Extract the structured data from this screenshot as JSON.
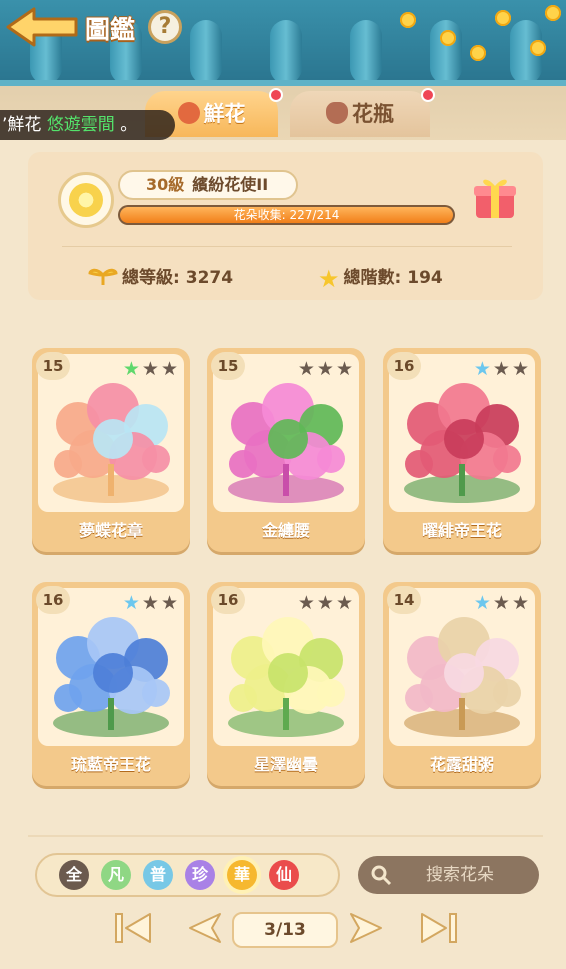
{
  "header": {
    "title": "圖鑑",
    "help": "?"
  },
  "ticker": {
    "prefix": "’鮮花 ",
    "highlight": "悠遊雲間",
    "suffix": " 。"
  },
  "tabs": [
    {
      "label": "鮮花",
      "active": true
    },
    {
      "label": "花瓶",
      "active": false
    }
  ],
  "profile": {
    "level": "30級",
    "rank_title": "繽紛花使II",
    "progress_label": "花朵收集:",
    "progress_value": "227/214",
    "progress_fraction": 1.0,
    "total_level_label": "總等級:",
    "total_level": "3274",
    "total_rank_label": "總階數:",
    "total_rank": "194"
  },
  "cards": [
    {
      "name": "夢蝶花章",
      "level": "15",
      "stars": [
        "green",
        "off",
        "off"
      ]
    },
    {
      "name": "金纏腰",
      "level": "15",
      "stars": [
        "off",
        "off",
        "off"
      ]
    },
    {
      "name": "曜緋帝王花",
      "level": "16",
      "stars": [
        "blue",
        "off",
        "off"
      ]
    },
    {
      "name": "琉藍帝王花",
      "level": "16",
      "stars": [
        "blue",
        "off",
        "off"
      ]
    },
    {
      "name": "星澤幽曇",
      "level": "16",
      "stars": [
        "off",
        "off",
        "off"
      ]
    },
    {
      "name": "花露甜粥",
      "level": "14",
      "stars": [
        "blue",
        "off",
        "off"
      ]
    }
  ],
  "filters": [
    {
      "label": "全",
      "color": "#6b5a4e"
    },
    {
      "label": "凡",
      "color": "#8fd784"
    },
    {
      "label": "普",
      "color": "#78c8e6"
    },
    {
      "label": "珍",
      "color": "#a981e6"
    },
    {
      "label": "華",
      "color": "#f6b82f"
    },
    {
      "label": "仙",
      "color": "#ea4c4c"
    }
  ],
  "search": {
    "placeholder": "搜索花朵"
  },
  "pager": {
    "page": "3/13"
  }
}
